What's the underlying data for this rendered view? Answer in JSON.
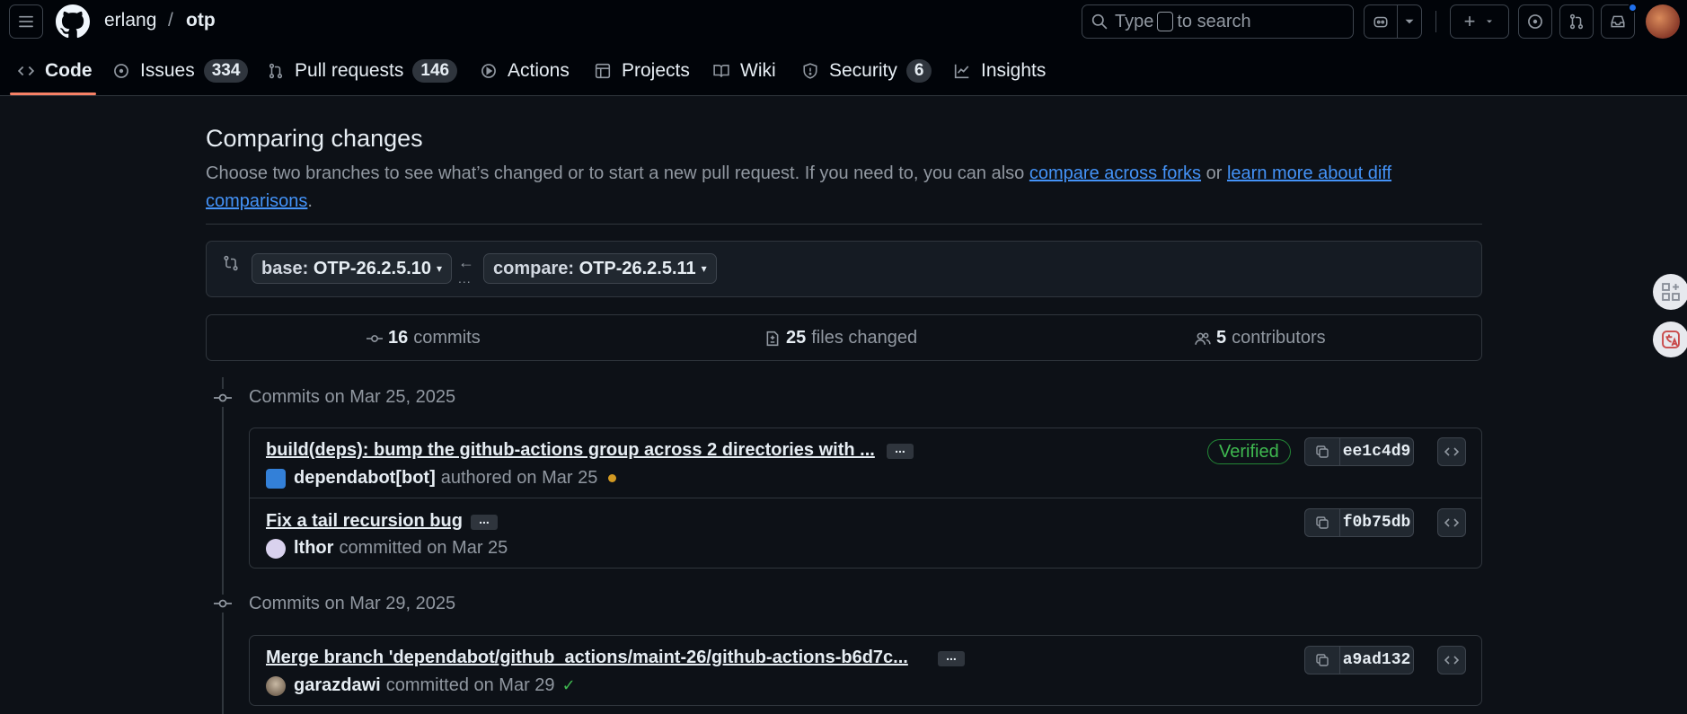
{
  "header": {
    "owner": "erlang",
    "separator": "/",
    "repo": "otp",
    "search_prefix": "Type",
    "search_suffix": "to search",
    "plus_label": "+"
  },
  "nav": {
    "tabs": [
      {
        "label": "Code"
      },
      {
        "label": "Issues",
        "count": "334"
      },
      {
        "label": "Pull requests",
        "count": "146"
      },
      {
        "label": "Actions"
      },
      {
        "label": "Projects"
      },
      {
        "label": "Wiki"
      },
      {
        "label": "Security",
        "count": "6"
      },
      {
        "label": "Insights"
      }
    ]
  },
  "compare": {
    "title": "Comparing changes",
    "description_prefix": "Choose two branches to see what’s changed or to start a new pull request. If you need to, you can also",
    "link_forks": "compare across forks",
    "or": "or",
    "link_learn": "learn more about diff comparisons",
    "period": ".",
    "base_label": "base:",
    "base_value": "OTP-26.2.5.10",
    "compare_label": "compare:",
    "compare_value": "OTP-26.2.5.11",
    "arrow": "←",
    "dots": "..."
  },
  "stats": {
    "commits_count": "16",
    "commits_label": "commits",
    "files_count": "25",
    "files_label": "files changed",
    "contributors_count": "5",
    "contributors_label": "contributors"
  },
  "groups": [
    {
      "heading": "Commits on Mar 25, 2025",
      "commits": [
        {
          "title": "build(deps): bump the github-actions group across 2 directories with ...",
          "author": "dependabot[bot]",
          "action": "authored on Mar 25",
          "verified": "Verified",
          "sha": "ee1c4d9"
        },
        {
          "title": "Fix a tail recursion bug",
          "author": "lthor",
          "action": "committed on Mar 25",
          "sha": "f0b75db"
        }
      ]
    },
    {
      "heading": "Commits on Mar 29, 2025",
      "commits": [
        {
          "title": "Merge branch 'dependabot/github_actions/maint-26/github-actions-b6d7c...",
          "author": "garazdawi",
          "action": "committed on Mar 29",
          "sha": "a9ad132"
        }
      ]
    }
  ],
  "ellipsis": "...",
  "colors": {
    "accent_underline": "#f78166",
    "link": "#4493f8",
    "verified": "#3fb950",
    "pending": "#d29922",
    "background": "#0d1117"
  }
}
